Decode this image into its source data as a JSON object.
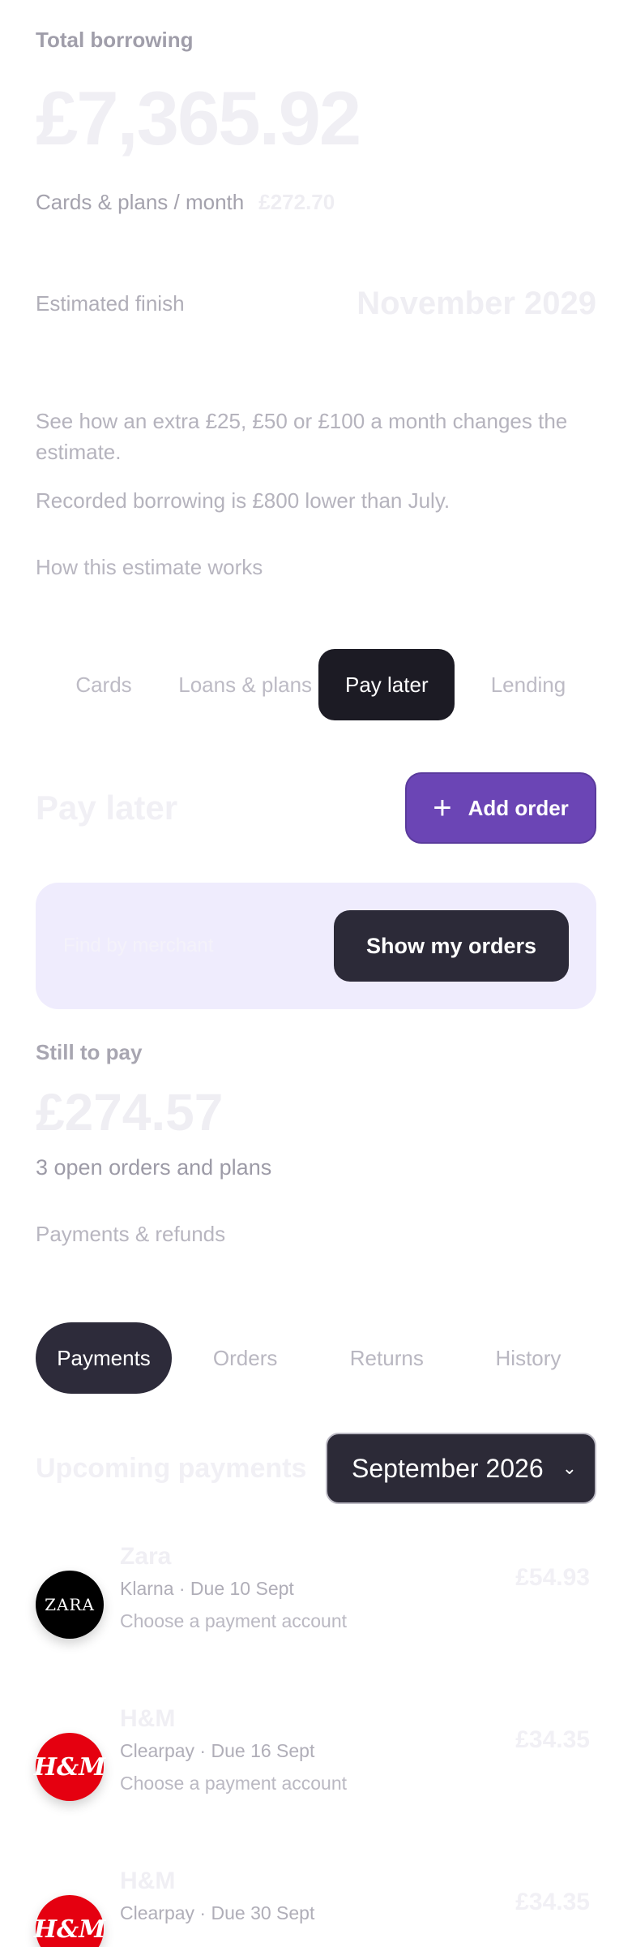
{
  "summary": {
    "total_label": "Total borrowing",
    "total_amount": "£7,365.92",
    "monthly_label": "Cards & plans / month",
    "monthly_value": "£272.70",
    "finish_label": "Estimated finish",
    "finish_value": "November 2029",
    "extra_text": "See how an extra £25, £50 or £100 a month changes the estimate.",
    "recorded_text": "Recorded borrowing is £800 lower than July.",
    "how_link": "How this estimate works"
  },
  "product_tabs": [
    {
      "label": "Cards",
      "active": false
    },
    {
      "label": "Loans & plans",
      "active": false
    },
    {
      "label": "Pay later",
      "active": true
    },
    {
      "label": "Lending",
      "active": false
    }
  ],
  "pay_later": {
    "title": "Pay later",
    "add_label": "Add order",
    "lookup_placeholder": "Find by merchant",
    "show_orders_label": "Show my orders",
    "still_to_pay_label": "Still to pay",
    "still_to_pay_amount": "£274.57",
    "open_count": "3 open orders and plans",
    "payments_refunds_link": "Payments & refunds"
  },
  "payment_tabs": [
    {
      "label": "Payments",
      "active": true
    },
    {
      "label": "Orders",
      "active": false
    },
    {
      "label": "Returns",
      "active": false
    },
    {
      "label": "History",
      "active": false
    }
  ],
  "upcoming": {
    "title": "Upcoming payments",
    "month": "September 2026",
    "rows": [
      {
        "merchant": "Zara",
        "logo": "ZARA",
        "meta": "Klarna · Due 10 Sept",
        "link": "Choose a payment account",
        "amount": "£54.93"
      },
      {
        "merchant": "H&M",
        "logo": "H&M",
        "meta": "Clearpay · Due 16 Sept",
        "link": "Choose a payment account",
        "amount": "£34.35"
      },
      {
        "merchant": "H&M",
        "logo": "H&M",
        "meta": "Clearpay · Due 30 Sept",
        "link": "",
        "amount": "£34.35"
      }
    ]
  },
  "colors": {
    "accent": "#6b45b5",
    "dark": "#1c1b24",
    "lookup_bg": "#efecfd"
  }
}
